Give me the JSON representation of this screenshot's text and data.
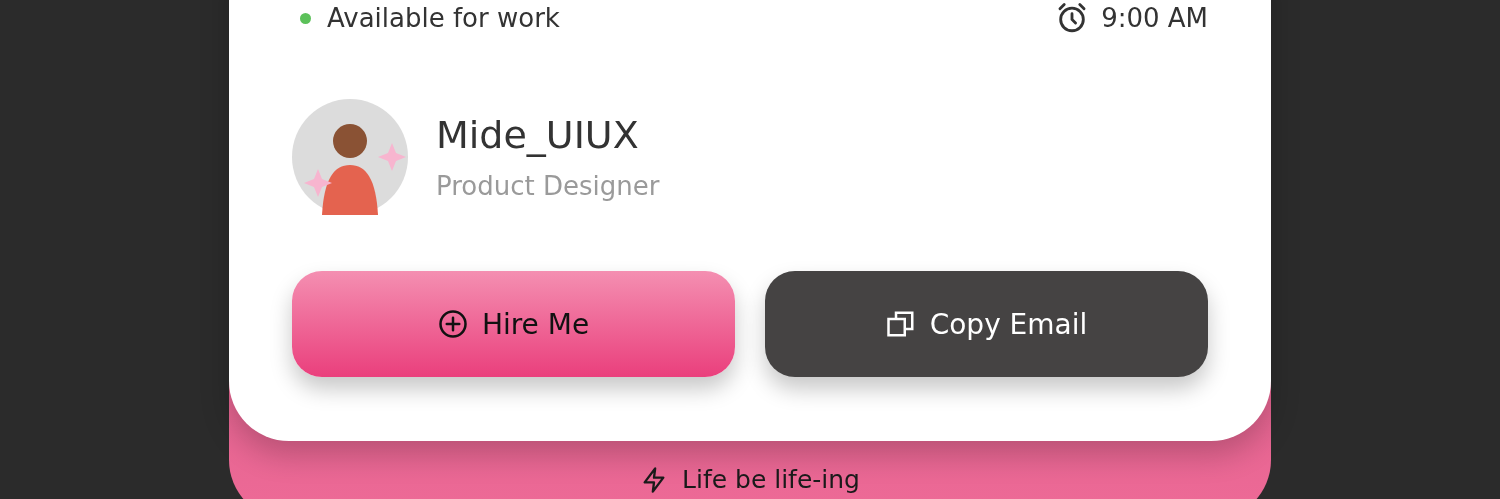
{
  "status": {
    "label": "Available for work",
    "color": "#5cc15a"
  },
  "time": "9:00 AM",
  "profile": {
    "name": "Mide_UIUX",
    "role": "Product Designer"
  },
  "buttons": [
    {
      "label": "Hire Me",
      "kind": "primary"
    },
    {
      "label": "Copy Email",
      "kind": "secondary"
    }
  ],
  "footer": "Life be life-ing"
}
